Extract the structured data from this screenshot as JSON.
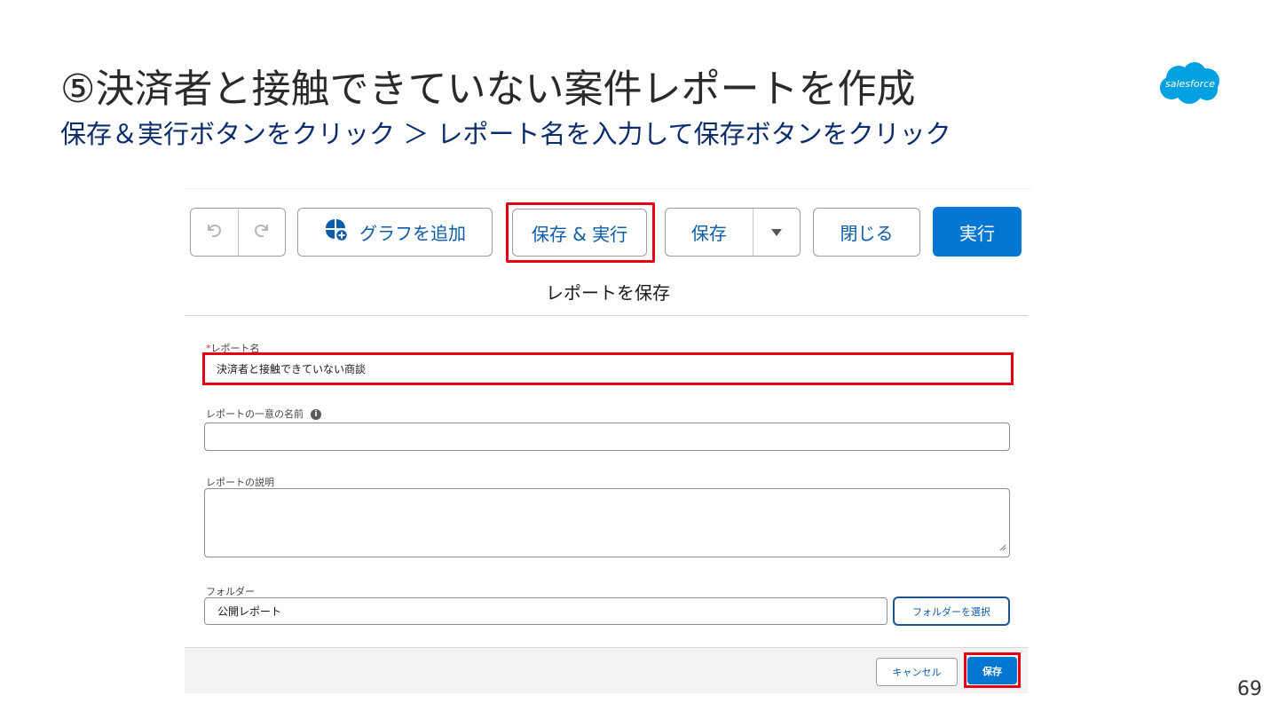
{
  "slide": {
    "title": "⑤決済者と接触できていない案件レポートを作成",
    "subtitle": "保存＆実行ボタンをクリック ＞ レポート名を入力して保存ボタンをクリック",
    "page_number": "69",
    "logo_text": "salesforce"
  },
  "toolbar": {
    "add_chart_label": "グラフを追加",
    "save_run_label": "保存 & 実行",
    "save_label": "保存",
    "close_label": "閉じる",
    "run_label": "実行"
  },
  "dialog": {
    "title": "レポートを保存",
    "report_name_label": "レポート名",
    "report_name_value": "決済者と接触できていない商談",
    "unique_name_label": "レポートの一意の名前",
    "unique_name_value": "",
    "description_label": "レポートの説明",
    "description_value": "",
    "folder_label": "フォルダー",
    "folder_value": "公開レポート",
    "select_folder_label": "フォルダーを選択",
    "cancel_label": "キャンセル",
    "save_label": "保存"
  },
  "colors": {
    "brand_blue": "#0176d3",
    "highlight_red": "#e50012",
    "subtitle_navy": "#0b2d6e",
    "logo_blue": "#00a1e0"
  }
}
